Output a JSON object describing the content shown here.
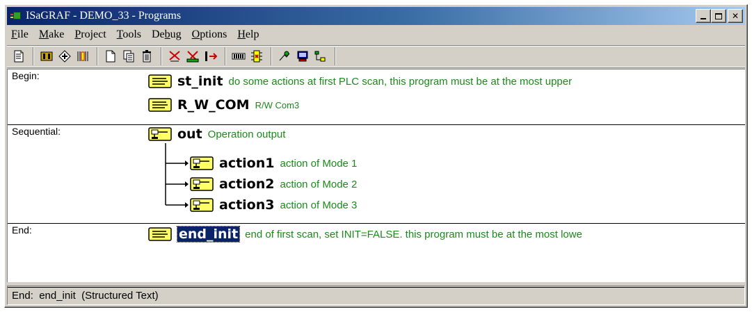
{
  "window": {
    "title": "ISaGRAF - DEMO_33 - Programs"
  },
  "menu": [
    {
      "label": "File",
      "accel_index": 0
    },
    {
      "label": "Make",
      "accel_index": 0
    },
    {
      "label": "Project",
      "accel_index": 0
    },
    {
      "label": "Tools",
      "accel_index": 0
    },
    {
      "label": "Debug",
      "accel_index": 2
    },
    {
      "label": "Options",
      "accel_index": 0
    },
    {
      "label": "Help",
      "accel_index": 0
    }
  ],
  "toolbar": {
    "icons": [
      "edit-description-icon",
      "dictionary-icon",
      "compile-icon",
      "io-connection-icon",
      "new-program-icon",
      "copy-program-icon",
      "delete-program-icon",
      "make-icon",
      "verify-icon",
      "link-icon",
      "simulate-icon",
      "debug-icon",
      "archive-icon",
      "terminal-icon",
      "library-icon"
    ]
  },
  "sections": {
    "begin": {
      "label": "Begin:",
      "programs": [
        {
          "name": "st_init",
          "description": "do some actions at first PLC scan, this program must be at the most upper"
        },
        {
          "name": "R_W_COM",
          "description": "R/W Com3"
        }
      ]
    },
    "sequential": {
      "label": "Sequential:",
      "parent": {
        "name": "out",
        "description": "Operation output"
      },
      "children": [
        {
          "name": "action1",
          "description": "action of Mode 1"
        },
        {
          "name": "action2",
          "description": "action of Mode 2"
        },
        {
          "name": "action3",
          "description": "action of Mode 3"
        }
      ]
    },
    "end": {
      "label": "End:",
      "programs": [
        {
          "name": "end_init",
          "description": "end of first scan, set INIT=FALSE. this program must be at the most lowe",
          "selected": true
        }
      ]
    }
  },
  "status": {
    "text": "End:  end_init  (Structured Text)"
  },
  "colors": {
    "title_gradient_start": "#0a246a",
    "description_green": "#1a8a1a",
    "selection": "#0a246a",
    "chrome": "#d4d0c8"
  }
}
